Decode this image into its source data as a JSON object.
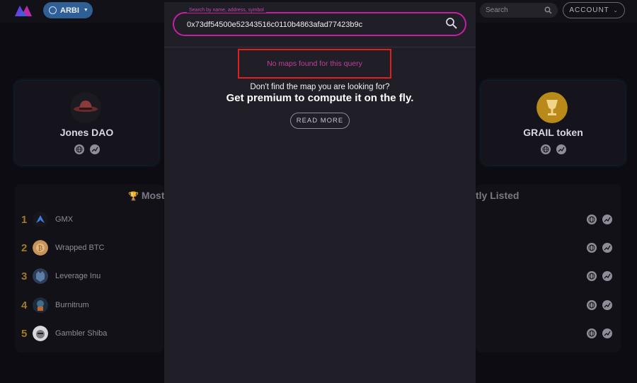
{
  "header": {
    "chain_label": "ARBI",
    "search_placeholder": "Search",
    "account_label": "ACCOUNT"
  },
  "featured": [
    {
      "name": "Jones DAO"
    },
    {
      "name": "GRAIL token"
    }
  ],
  "lists": {
    "left_title_partial": "Most",
    "right_title_partial": "tly Listed",
    "items": [
      {
        "rank": "1",
        "name": "GMX"
      },
      {
        "rank": "2",
        "name": "Wrapped BTC"
      },
      {
        "rank": "3",
        "name": "Leverage Inu"
      },
      {
        "rank": "4",
        "name": "Burnitrum"
      },
      {
        "rank": "5",
        "name": "Gambler Shiba"
      }
    ]
  },
  "modal": {
    "search_label": "Search by name, address, symbol",
    "search_value": "0x73df54500e52343516c0110b4863afad77423b9c",
    "no_results": "No maps found for this query",
    "hint": "Don't find the map you are looking for?",
    "premium": "Get premium to compute it on the fly.",
    "read_more": "READ MORE"
  },
  "colors": {
    "accent_pink": "#c71fa3",
    "highlight_red": "#e11f1f",
    "chain_blue": "#2f5f95",
    "rank_gold": "#a07a1e"
  }
}
